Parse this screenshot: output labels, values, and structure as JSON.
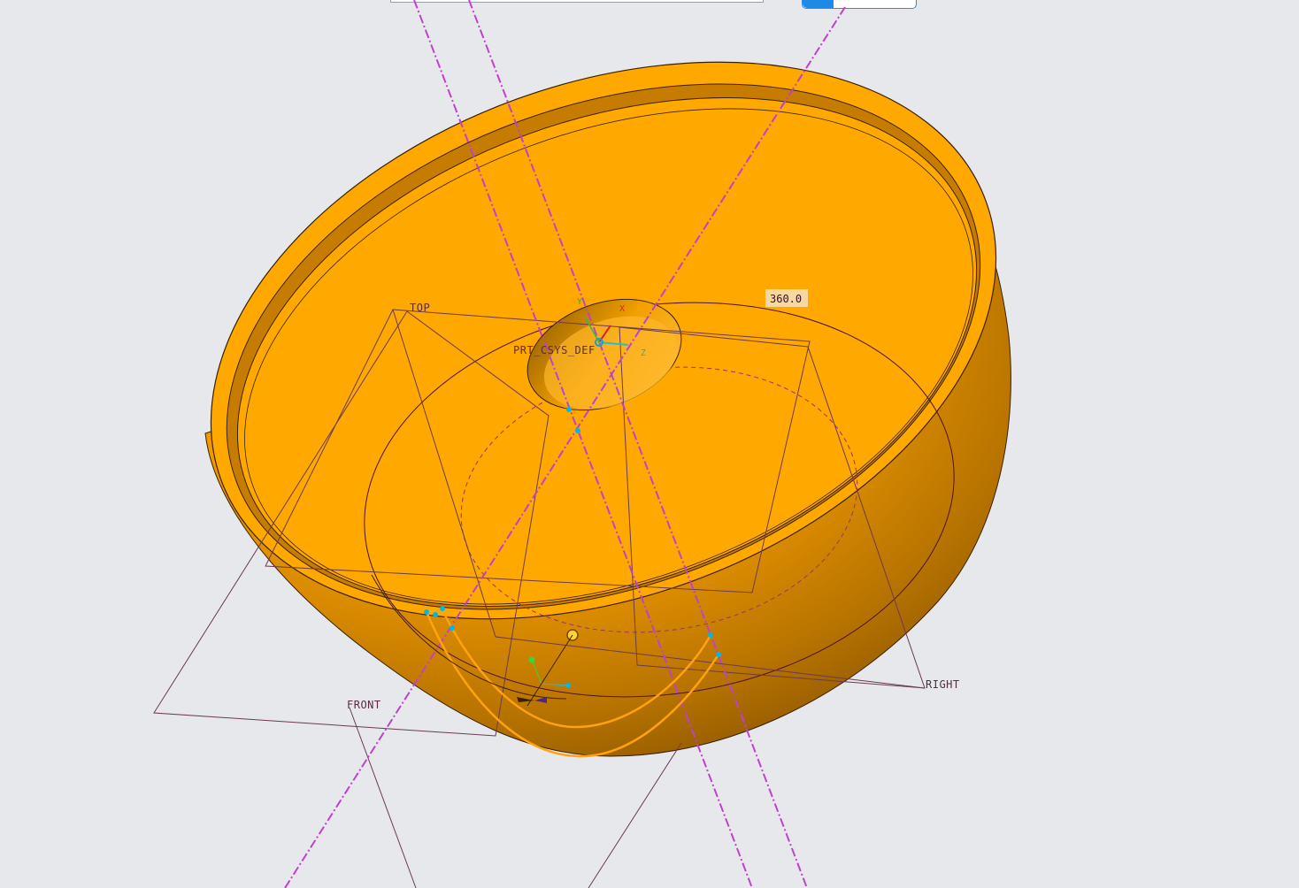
{
  "viewport": {
    "datum_planes": {
      "top": "TOP",
      "front": "FRONT",
      "right": "RIGHT",
      "csys": "PRT_CSYS_DEF"
    },
    "dimension": "360.0",
    "colors": {
      "background": "#e6e8ec",
      "part_fill": "#ffa800",
      "part_dark": "#8a5400",
      "datum_axis": "#c040d0",
      "datum_plane": "#6b3a52",
      "sketch_curve": "#ffa20f",
      "handle": "#00b8e8"
    }
  },
  "toolbar": {
    "progress": 0.27
  }
}
